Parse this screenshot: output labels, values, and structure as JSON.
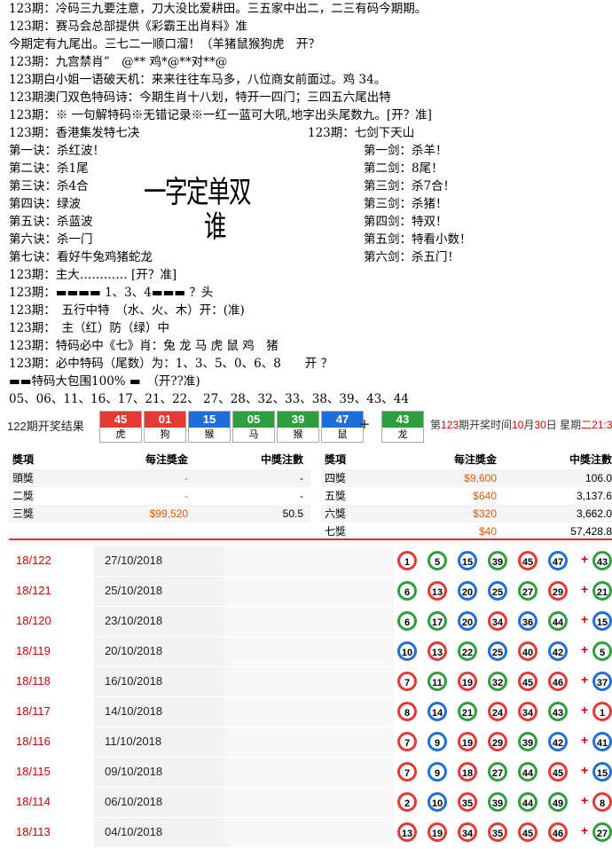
{
  "lines": [
    "123期：冷码三九要注意，刀大没比爱耕田。三五家中出二，二三有码今期期。",
    "123期：赛马会总部提供《彩霸王出肖料》准",
    "今期定有九尾出。三七二一顺口溜！（羊猪鼠猴狗虎　开？",
    "123期：九宫禁肖”　@** 鸡*@**对**@",
    "123期白小姐一语破天机：来来往往车马多，八位商女前面过。鸡 34。",
    "123期澳门双色特码诗：今期生肖十八划，特开一四门；三四五六尾出特",
    "123期：※ 一句解特码※无错记录※一红一蓝可大吼,地字出头尾数九。[开？准]"
  ],
  "left_title": "123期：香港集发特七决",
  "right_title": "123期：七剑下天山",
  "left_items": [
    "第一诀：杀红波！",
    "第二诀：杀1尾",
    "第三诀：杀4合",
    "第四诀：绿波",
    "第五诀：杀蓝波",
    "第六诀：杀一门",
    "第七诀：看好牛兔鸡猪蛇龙"
  ],
  "right_items": [
    "第一剑：杀羊！",
    "第二剑：8尾！",
    "第三剑：杀7合！",
    "第三剑：杀猪！",
    "第四剑：特双！",
    "第五剑：特看小数！",
    "第六剑：杀五门！"
  ],
  "big_text": "一字定单双",
  "big_text2": "谁",
  "lower_lines": [
    "123期：主大………… [开？准]",
    "123期：▬▬▬▬ 1、3、4▬▬▬ ？头",
    "123期：　五行中特　（水、火、木）开：(准)",
    "123期：　主（红）防（绿）中",
    "123期：特码必中《七》肖：兔 龙 马 虎 鼠 鸡　猪",
    "123期：必中特码（尾数）为：1、3、5、0、6、8　　开 ？",
    "▬▬特码大包围100% ▬　（开??准)",
    "05、06、11、16、17、21、22、 27、28、32、33、38、39、43、44"
  ],
  "strip": {
    "label": "122期开奖结果",
    "balls": [
      {
        "num": "45",
        "zod": "虎",
        "color": "#e53935"
      },
      {
        "num": "01",
        "zod": "狗",
        "color": "#e53935"
      },
      {
        "num": "15",
        "zod": "猴",
        "color": "#1e6fd9"
      },
      {
        "num": "05",
        "zod": "马",
        "color": "#2e9e3e"
      },
      {
        "num": "39",
        "zod": "猴",
        "color": "#2e9e3e"
      },
      {
        "num": "47",
        "zod": "鼠",
        "color": "#1e6fd9"
      }
    ],
    "special": {
      "num": "43",
      "zod": "龙",
      "color": "#2e9e3e"
    },
    "time_prefix": "第",
    "time_issue": "123",
    "time_mid": "期开奖时间",
    "time_month": "10",
    "time_m": "月",
    "time_day": "30",
    "time_d": "日  星期",
    "time_week": "二",
    "time_clock": "21:3"
  },
  "prize_left": {
    "headers": [
      "獎項",
      "每注獎金",
      "中獎注數"
    ],
    "rows": [
      [
        "頭獎",
        "-",
        "-"
      ],
      [
        "二獎",
        "-",
        "-"
      ],
      [
        "三獎",
        "$99,520",
        "50.5"
      ]
    ]
  },
  "prize_right": {
    "headers": [
      "獎項",
      "每注獎金",
      "中獎注數"
    ],
    "rows": [
      [
        "四獎",
        "$9,600",
        "106.0"
      ],
      [
        "五獎",
        "$640",
        "3,137.6"
      ],
      [
        "六獎",
        "$320",
        "3,662.0"
      ],
      [
        "七獎",
        "$40",
        "57,428.8"
      ]
    ]
  },
  "history": [
    {
      "issue": "18/122",
      "date": "27/10/2018",
      "balls": [
        "1",
        "5",
        "15",
        "39",
        "45",
        "47"
      ],
      "colors": [
        "red",
        "green",
        "blue",
        "green",
        "red",
        "blue"
      ],
      "sp": "43",
      "spc": "green"
    },
    {
      "issue": "18/121",
      "date": "25/10/2018",
      "balls": [
        "6",
        "13",
        "20",
        "25",
        "27",
        "29"
      ],
      "colors": [
        "green",
        "red",
        "blue",
        "blue",
        "green",
        "red"
      ],
      "sp": "21",
      "spc": "green"
    },
    {
      "issue": "18/120",
      "date": "23/10/2018",
      "balls": [
        "6",
        "17",
        "20",
        "34",
        "36",
        "44"
      ],
      "colors": [
        "green",
        "green",
        "blue",
        "red",
        "blue",
        "green"
      ],
      "sp": "15",
      "spc": "blue"
    },
    {
      "issue": "18/119",
      "date": "20/10/2018",
      "balls": [
        "10",
        "13",
        "22",
        "25",
        "40",
        "42"
      ],
      "colors": [
        "blue",
        "red",
        "green",
        "blue",
        "red",
        "blue"
      ],
      "sp": "5",
      "spc": "green"
    },
    {
      "issue": "18/118",
      "date": "16/10/2018",
      "balls": [
        "7",
        "11",
        "19",
        "32",
        "45",
        "46"
      ],
      "colors": [
        "red",
        "green",
        "red",
        "green",
        "red",
        "red"
      ],
      "sp": "37",
      "spc": "blue"
    },
    {
      "issue": "18/117",
      "date": "14/10/2018",
      "balls": [
        "8",
        "14",
        "21",
        "24",
        "34",
        "43"
      ],
      "colors": [
        "red",
        "blue",
        "green",
        "red",
        "red",
        "green"
      ],
      "sp": "1",
      "spc": "red"
    },
    {
      "issue": "18/116",
      "date": "11/10/2018",
      "balls": [
        "7",
        "9",
        "19",
        "29",
        "39",
        "42"
      ],
      "colors": [
        "red",
        "blue",
        "red",
        "red",
        "green",
        "blue"
      ],
      "sp": "41",
      "spc": "blue"
    },
    {
      "issue": "18/115",
      "date": "09/10/2018",
      "balls": [
        "7",
        "9",
        "18",
        "27",
        "44",
        "45"
      ],
      "colors": [
        "red",
        "blue",
        "red",
        "green",
        "green",
        "red"
      ],
      "sp": "15",
      "spc": "blue"
    },
    {
      "issue": "18/114",
      "date": "06/10/2018",
      "balls": [
        "2",
        "10",
        "35",
        "39",
        "44",
        "49"
      ],
      "colors": [
        "red",
        "blue",
        "red",
        "green",
        "green",
        "green"
      ],
      "sp": "8",
      "spc": "red"
    },
    {
      "issue": "18/113",
      "date": "04/10/2018",
      "balls": [
        "13",
        "19",
        "34",
        "35",
        "45",
        "46"
      ],
      "colors": [
        "red",
        "red",
        "red",
        "red",
        "red",
        "red"
      ],
      "sp": "27",
      "spc": "green"
    }
  ]
}
